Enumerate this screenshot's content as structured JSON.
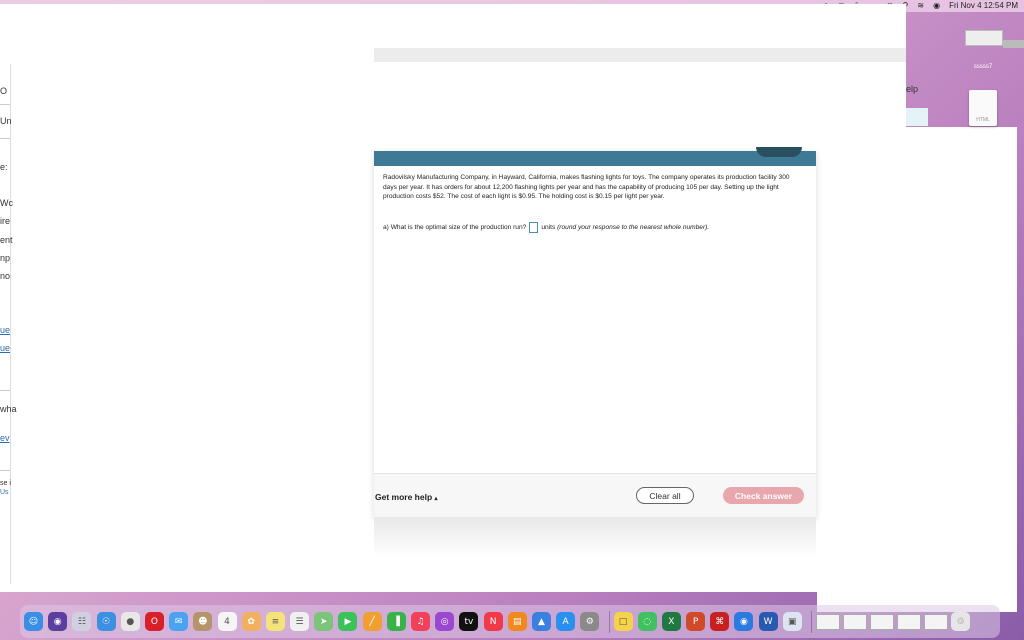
{
  "menubar": {
    "date_time": "Fri Nov 4  12:54 PM"
  },
  "background_window": {
    "help_fragment": "elp",
    "left_fragments": [
      "O",
      "Un",
      "e:",
      "Wc",
      "ire",
      "ent",
      "np",
      "no",
      "ue",
      "ue",
      "wha",
      "ev",
      "se i",
      "Us"
    ]
  },
  "desktop": {
    "file_label": "sssss7",
    "file_ext": "HTML"
  },
  "problem": {
    "text": "Radovilsky Manufacturing Company, in Hayward, California, makes flashing lights for toys. The company operates its production facility 300 days per year. It has orders for about 12,200 flashing lights per year and has the capability of producing 105 per day. Setting up the light production costs $52. The cost of each light is $0.95. The holding cost is $0.15 per light per year.",
    "question": "a) What is the optimal size of the production run?",
    "answer_value": "",
    "units": "units",
    "hint": "(round your response to the nearest whole number)."
  },
  "footer": {
    "help_label": "Get more help",
    "help_arrow": "▴",
    "clear_label": "Clear all",
    "check_label": "Check answer"
  },
  "dock": {
    "icons": [
      {
        "name": "finder-icon",
        "color": "#3a8ee6",
        "glyph": "☺"
      },
      {
        "name": "siri-icon",
        "color": "#5a3fa0",
        "glyph": "◉"
      },
      {
        "name": "launchpad-icon",
        "color": "#d0d0e0",
        "glyph": "☷"
      },
      {
        "name": "safari-icon",
        "color": "#3d8fe0",
        "glyph": "☉"
      },
      {
        "name": "chrome-icon",
        "color": "#e8e8e8",
        "glyph": "●"
      },
      {
        "name": "opera-icon",
        "color": "#d8202a",
        "glyph": "O"
      },
      {
        "name": "mail-icon",
        "color": "#4aa3f0",
        "glyph": "✉"
      },
      {
        "name": "contacts-icon",
        "color": "#b5946a",
        "glyph": "☻"
      },
      {
        "name": "calendar-icon",
        "color": "#f5f5f5",
        "glyph": "4"
      },
      {
        "name": "photos-icon",
        "color": "#f1b060",
        "glyph": "✿"
      },
      {
        "name": "notes-icon",
        "color": "#f4e27a",
        "glyph": "≡"
      },
      {
        "name": "reminders-icon",
        "color": "#f0f0f0",
        "glyph": "☰"
      },
      {
        "name": "maps-icon",
        "color": "#7cc47a",
        "glyph": "➤"
      },
      {
        "name": "facetime-icon",
        "color": "#3cc25a",
        "glyph": "▶"
      },
      {
        "name": "freeform-icon",
        "color": "#f0a030",
        "glyph": "╱"
      },
      {
        "name": "numbers-icon",
        "color": "#38b34a",
        "glyph": "▐"
      },
      {
        "name": "music-icon",
        "color": "#f0405a",
        "glyph": "♫"
      },
      {
        "name": "podcasts-icon",
        "color": "#9a48d0",
        "glyph": "◎"
      },
      {
        "name": "appletv-icon",
        "color": "#111111",
        "glyph": "tv"
      },
      {
        "name": "news-icon",
        "color": "#f03a4a",
        "glyph": "N"
      },
      {
        "name": "books-icon",
        "color": "#f08a20",
        "glyph": "▤"
      },
      {
        "name": "keynote-icon",
        "color": "#3a80e0",
        "glyph": "▲"
      },
      {
        "name": "appstore-icon",
        "color": "#2a90f0",
        "glyph": "A"
      },
      {
        "name": "settings-icon",
        "color": "#8a8a8a",
        "glyph": "⚙"
      },
      {
        "name": "stickies-icon",
        "color": "#f4d24a",
        "glyph": "□"
      },
      {
        "name": "messages-icon",
        "color": "#40c060",
        "glyph": "◌"
      },
      {
        "name": "excel-icon",
        "color": "#1e7a40",
        "glyph": "X"
      },
      {
        "name": "powerpoint-icon",
        "color": "#d04a2a",
        "glyph": "P"
      },
      {
        "name": "acrobat-icon",
        "color": "#c82020",
        "glyph": "⌘"
      },
      {
        "name": "zoom-icon",
        "color": "#2a7ae0",
        "glyph": "◉"
      },
      {
        "name": "word-icon",
        "color": "#2a5ab0",
        "glyph": "W"
      },
      {
        "name": "preview-icon",
        "color": "#dde6f0",
        "glyph": "▣"
      }
    ]
  }
}
